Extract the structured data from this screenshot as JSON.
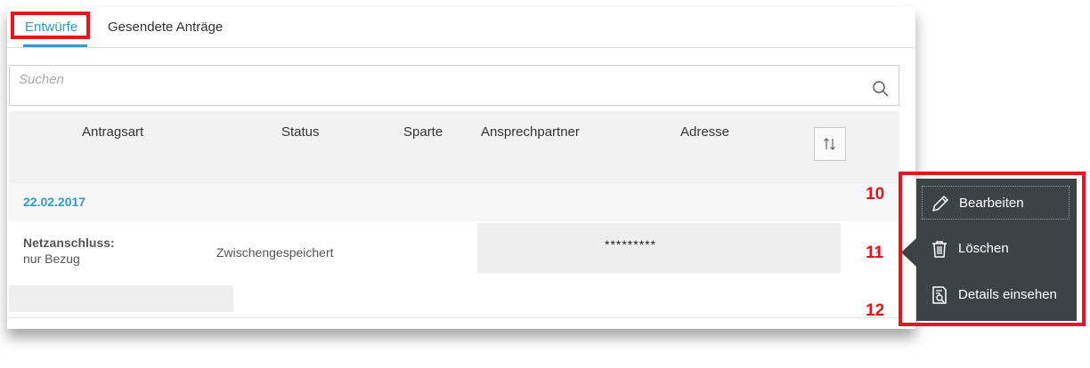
{
  "tabs": [
    {
      "label": "Entwürfe"
    },
    {
      "label": "Gesendete Anträge"
    }
  ],
  "search": {
    "placeholder": "Suchen",
    "value": ""
  },
  "columns": [
    "Antragsart",
    "Status",
    "Sparte",
    "Ansprechpartner",
    "Adresse"
  ],
  "groups": [
    {
      "date": "22.02.2017",
      "rows": [
        {
          "type": "Netzanschluss:",
          "subtype": "nur Bezug",
          "status": "Zwischengespeichert",
          "address": "*********"
        }
      ]
    }
  ],
  "context_menu": {
    "items": [
      {
        "label": "Bearbeiten",
        "icon": "pencil-icon"
      },
      {
        "label": "Löschen",
        "icon": "trash-icon"
      },
      {
        "label": "Details einsehen",
        "icon": "document-search-icon"
      }
    ]
  },
  "annotations": [
    "10",
    "11",
    "12"
  ],
  "colors": {
    "accent": "#2b9bd1",
    "highlight": "#e6171b",
    "menu_bg": "#3c4346"
  }
}
